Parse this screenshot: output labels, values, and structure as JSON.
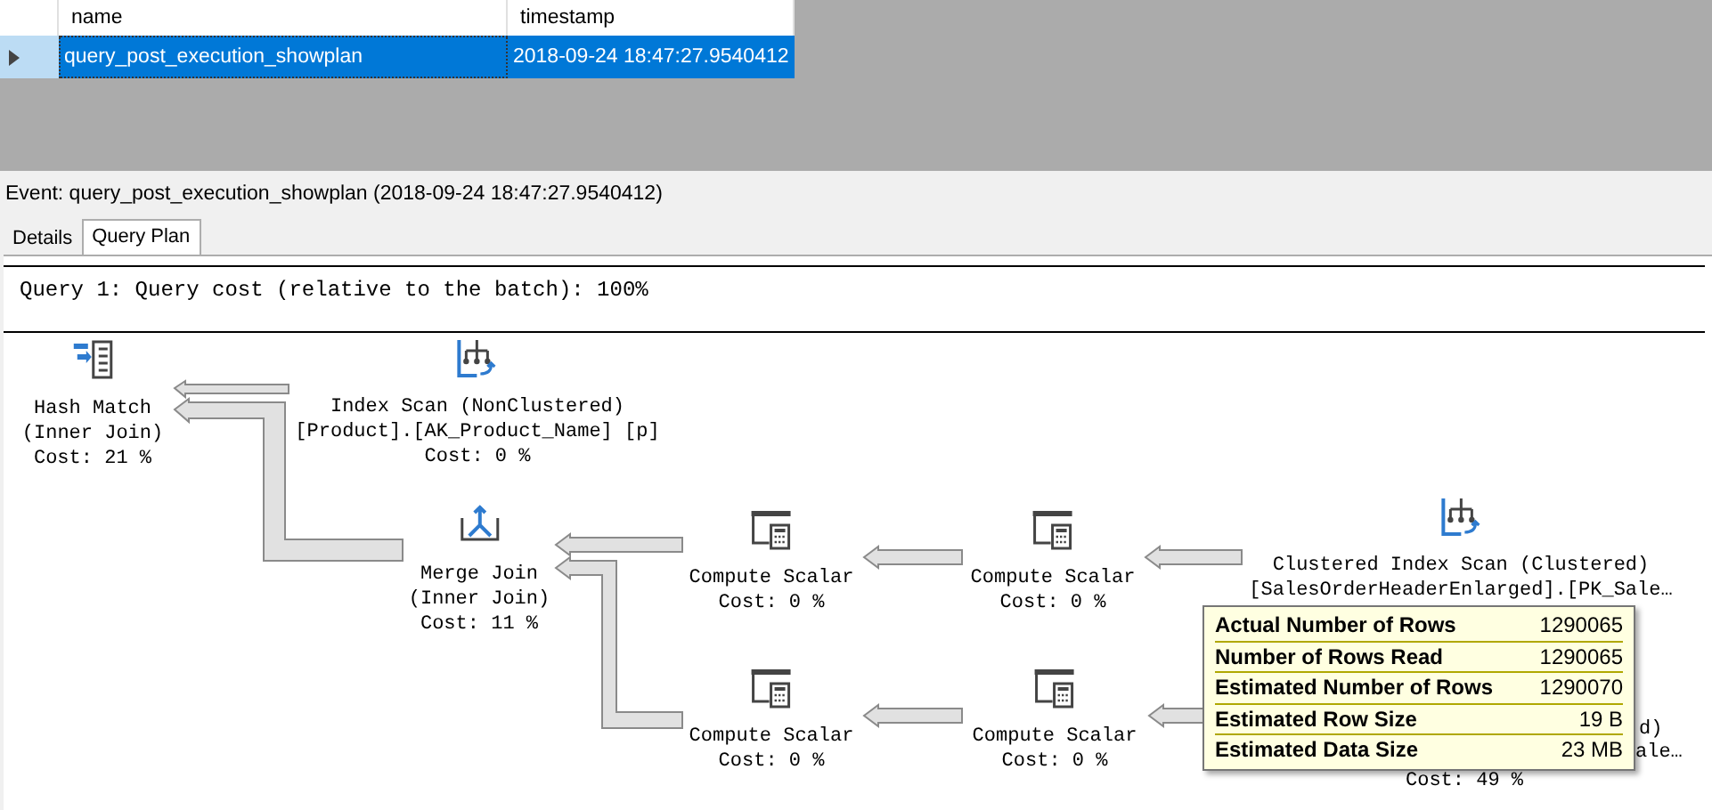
{
  "grid": {
    "columns": [
      "name",
      "timestamp"
    ],
    "rows": [
      {
        "selected": true,
        "cells": [
          "query_post_execution_showplan",
          "2018-09-24 18:47:27.9540412"
        ]
      }
    ]
  },
  "event_label": "Event: query_post_execution_showplan (2018-09-24 18:47:27.9540412)",
  "tabs": [
    {
      "label": "Details",
      "selected": false
    },
    {
      "label": "Query Plan",
      "selected": true
    }
  ],
  "plan": {
    "header": "Query 1: Query cost (relative to the batch): 100%",
    "nodes": [
      {
        "kind": "hash_match",
        "lines": [
          "Hash Match",
          "(Inner Join)"
        ],
        "cost": "Cost: 21 %"
      },
      {
        "kind": "index_scan",
        "lines": [
          "Index Scan (NonClustered)",
          "[Product].[AK_Product_Name] [p]"
        ],
        "cost": "Cost: 0 %"
      },
      {
        "kind": "merge_join",
        "lines": [
          "Merge Join",
          "(Inner Join)"
        ],
        "cost": "Cost: 11 %"
      },
      {
        "kind": "compute_scalar",
        "lines": [
          "Compute Scalar"
        ],
        "cost": "Cost: 0 %"
      },
      {
        "kind": "compute_scalar",
        "lines": [
          "Compute Scalar"
        ],
        "cost": "Cost: 0 %"
      },
      {
        "kind": "clustered_index_scan",
        "lines": [
          "Clustered Index Scan (Clustered)",
          "[SalesOrderHeaderEnlarged].[PK_Sale…"
        ]
      },
      {
        "kind": "compute_scalar",
        "lines": [
          "Compute Scalar"
        ],
        "cost": "Cost: 0 %"
      },
      {
        "kind": "compute_scalar",
        "lines": [
          "Compute Scalar"
        ],
        "cost": "Cost: 0 %"
      },
      {
        "kind": "covered",
        "lines": [
          "d)",
          "ale…"
        ],
        "cost": "Cost: 49 %"
      }
    ],
    "tooltip": [
      {
        "label": "Actual Number of Rows",
        "value": "1290065"
      },
      {
        "label": "Number of Rows Read",
        "value": "1290065"
      },
      {
        "label": "Estimated Number of Rows",
        "value": "1290070"
      },
      {
        "label": "Estimated Row Size",
        "value": "19 B"
      },
      {
        "label": "Estimated Data Size",
        "value": "23 MB"
      }
    ]
  }
}
